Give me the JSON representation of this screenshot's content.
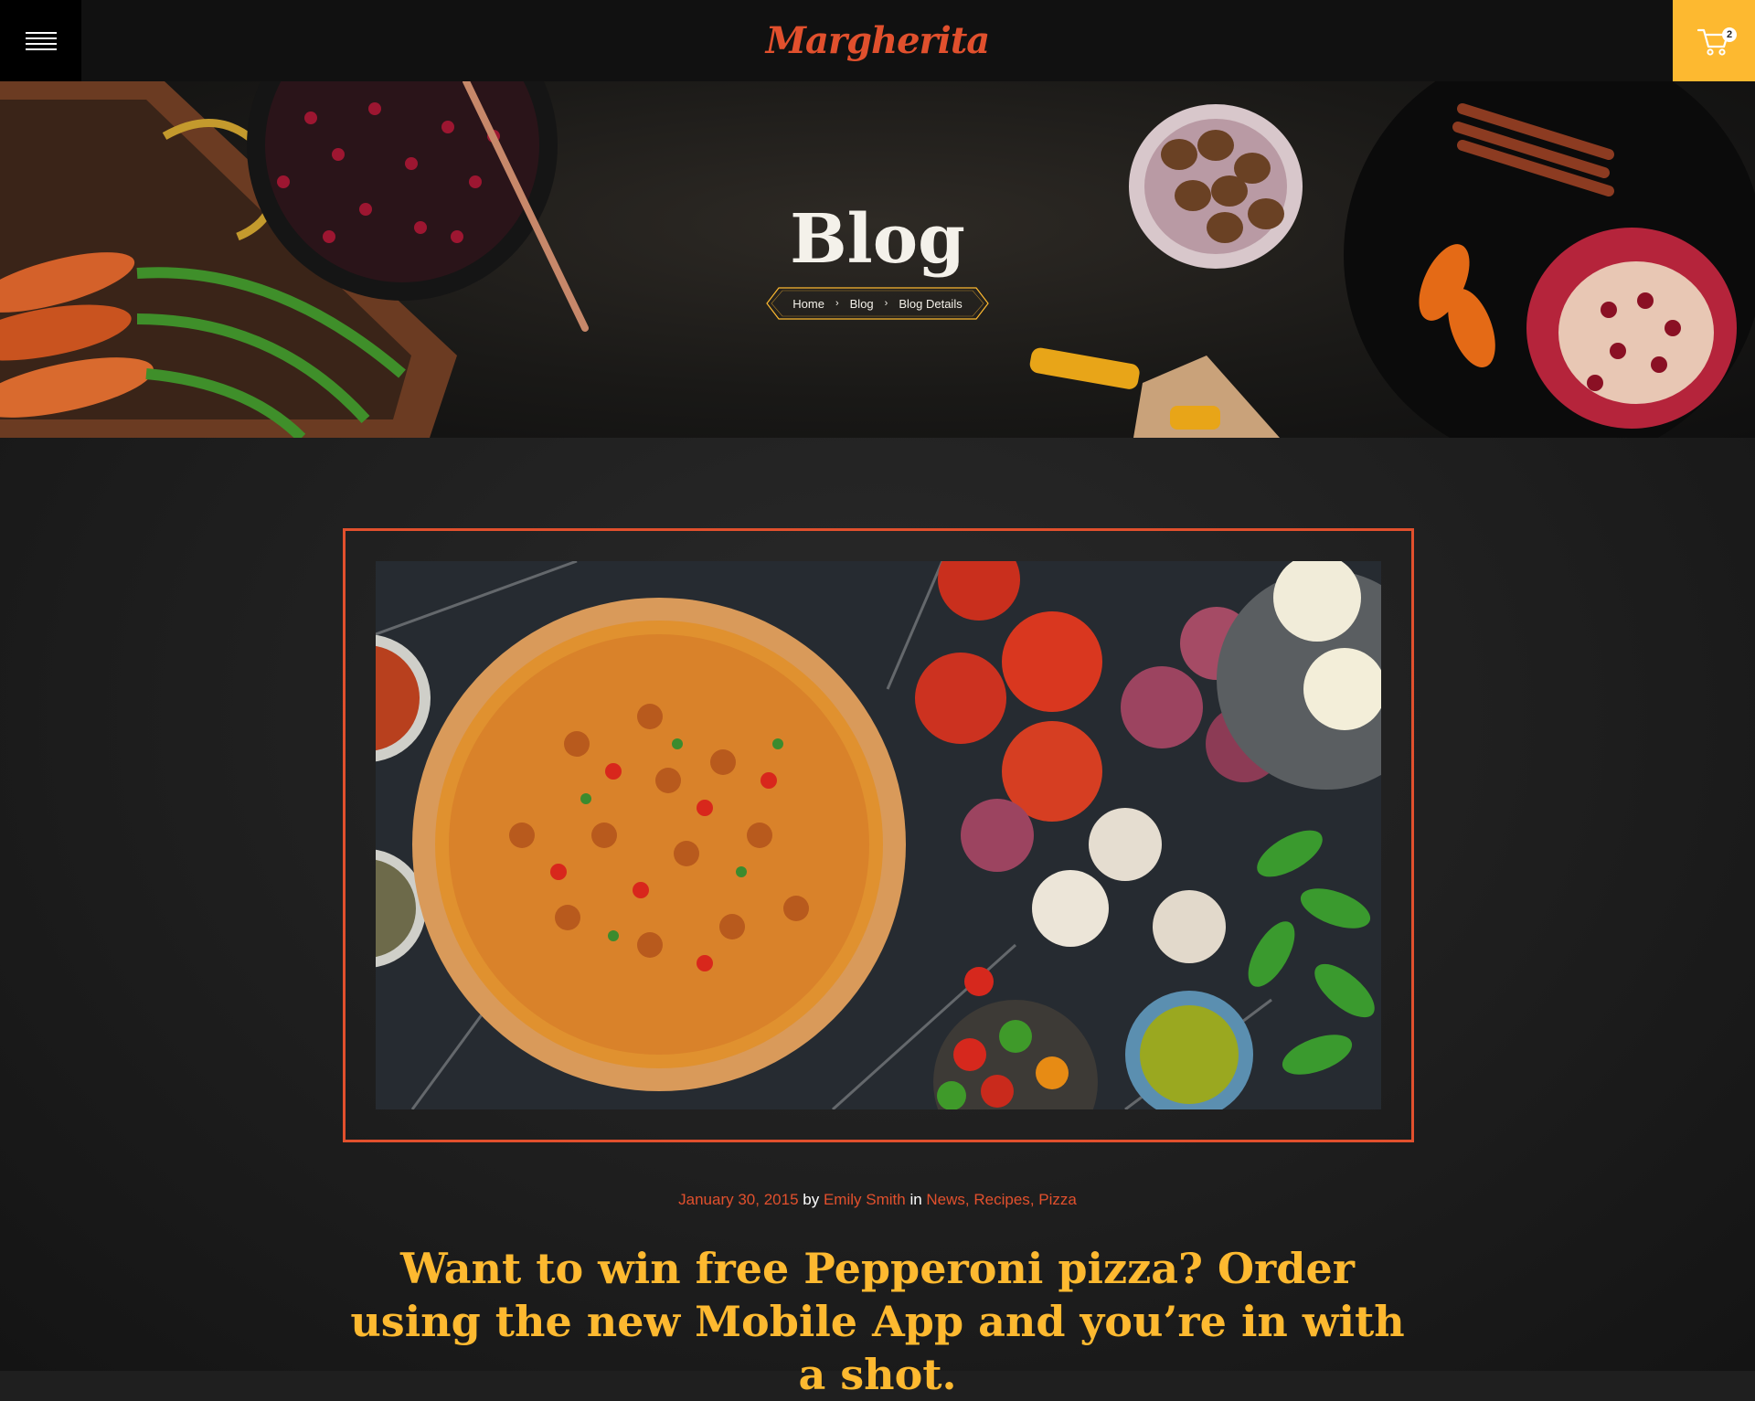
{
  "header": {
    "logo_text": "Margherita",
    "cart_count": "2",
    "accent_color": "#fdb930",
    "brand_color": "#e1502d"
  },
  "hero": {
    "title": "Blog",
    "breadcrumb": [
      {
        "label": "Home"
      },
      {
        "label": "Blog"
      },
      {
        "label": "Blog Details"
      }
    ]
  },
  "post": {
    "date": "January 30, 2015",
    "by_word": "by",
    "author": "Emily Smith",
    "in_word": "in",
    "categories": [
      "News",
      "Recipes",
      "Pizza"
    ],
    "title": "Want to win free Pepperoni pizza? Order using the new Mobile App and you’re in with a shot."
  }
}
